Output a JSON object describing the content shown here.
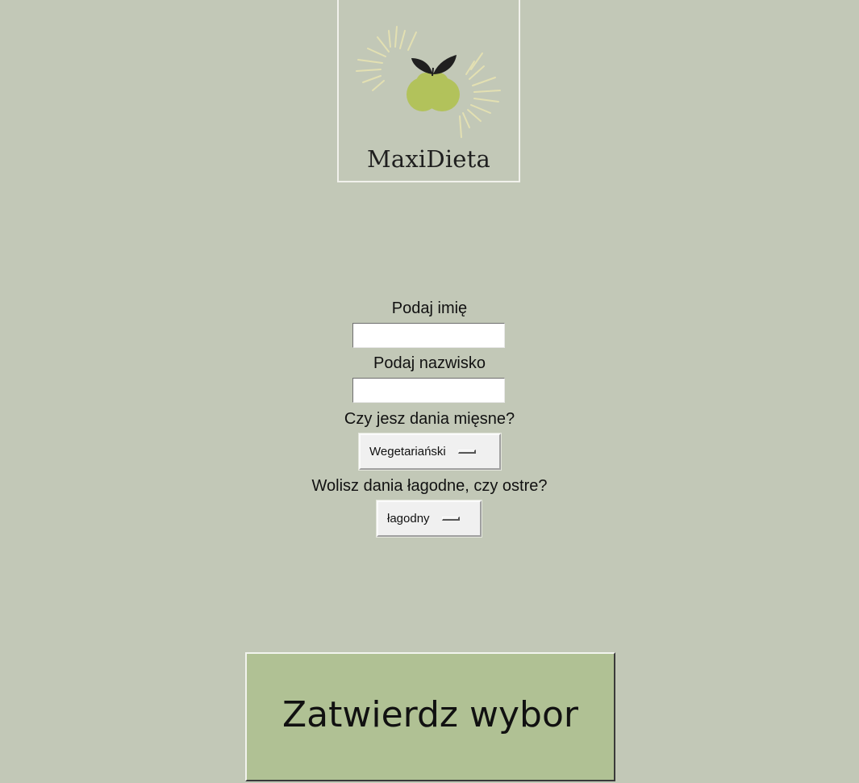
{
  "logo": {
    "brand_name": "MaxiDieta",
    "icon": "lemon-leaf-logo-icon",
    "fruit_color": "#b2c25b",
    "leaf_color": "#1f1f1f",
    "ray_color": "#e3e0b2"
  },
  "form": {
    "first_name": {
      "label": "Podaj imię",
      "value": ""
    },
    "last_name": {
      "label": "Podaj nazwisko",
      "value": ""
    },
    "meat": {
      "label": "Czy jesz dania mięsne?",
      "selected": "Wegetariański"
    },
    "spice": {
      "label": "Wolisz dania łagodne, czy ostre?",
      "selected": "łagodny"
    }
  },
  "submit": {
    "label": "Zatwierdz wybor"
  },
  "colors": {
    "background": "#c2c8b7",
    "submit_button": "#b0c194"
  }
}
